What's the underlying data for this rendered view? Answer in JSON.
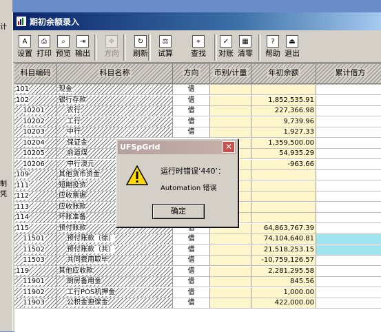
{
  "background_window": {
    "fragments": [
      "计",
      "制凭"
    ]
  },
  "window": {
    "title": "期初余额录入"
  },
  "toolbar": [
    {
      "key": "settings",
      "label": "设置",
      "icon": "A",
      "disabled": false
    },
    {
      "key": "print",
      "label": "打印",
      "icon": "⎙",
      "disabled": false
    },
    {
      "key": "preview",
      "label": "预览",
      "icon": "⌕",
      "disabled": false
    },
    {
      "key": "export",
      "label": "输出",
      "icon": "⇥",
      "disabled": false
    },
    {
      "key": "direction",
      "label": "方向",
      "icon": "✥",
      "disabled": true
    },
    {
      "key": "refresh",
      "label": "刷新",
      "icon": "↻",
      "disabled": false
    },
    {
      "key": "trial",
      "label": "试算",
      "icon": "⚖",
      "disabled": false
    },
    {
      "key": "find",
      "label": "查找",
      "icon": "⌖",
      "disabled": false
    },
    {
      "key": "reconcile",
      "label": "对账",
      "icon": "✓",
      "disabled": false
    },
    {
      "key": "clear",
      "label": "清零",
      "icon": "▦",
      "disabled": false
    },
    {
      "key": "help",
      "label": "帮助",
      "icon": "?",
      "disabled": false
    },
    {
      "key": "exit",
      "label": "退出",
      "icon": "⏏",
      "disabled": false
    }
  ],
  "grid": {
    "headers": [
      "科目编码",
      "科目名称",
      "方向",
      "币别/计量",
      "年初余额",
      "累计借方"
    ],
    "rows": [
      {
        "code": "101",
        "name": "现金",
        "dir": "借",
        "fc": "",
        "amount": "",
        "debit": ""
      },
      {
        "code": "102",
        "name": "银行存款",
        "dir": "借",
        "fc": "",
        "amount": "1,852,535.91",
        "debit": ""
      },
      {
        "code": "10201",
        "name": "农行",
        "dir": "借",
        "fc": "",
        "amount": "227,366.98",
        "debit": ""
      },
      {
        "code": "10202",
        "name": "工行",
        "dir": "借",
        "fc": "",
        "amount": "9,739.96",
        "debit": ""
      },
      {
        "code": "10203",
        "name": "中行",
        "dir": "借",
        "fc": "",
        "amount": "1,927.33",
        "debit": ""
      },
      {
        "code": "10204",
        "name": "保证金",
        "dir": "借",
        "fc": "",
        "amount": "1,359,500.00",
        "debit": ""
      },
      {
        "code": "10205",
        "name": "俞道煤",
        "dir": "借",
        "fc": "",
        "amount": "54,935.29",
        "debit": ""
      },
      {
        "code": "10206",
        "name": "中行澳元",
        "dir": "借",
        "fc": "",
        "amount": "-963.66",
        "debit": ""
      },
      {
        "code": "109",
        "name": "其他货币资金",
        "dir": "借",
        "fc": "",
        "amount": "",
        "debit": ""
      },
      {
        "code": "111",
        "name": "短期投资",
        "dir": "借",
        "fc": "",
        "amount": "",
        "debit": ""
      },
      {
        "code": "112",
        "name": "应收票据",
        "dir": "借",
        "fc": "",
        "amount": "",
        "debit": ""
      },
      {
        "code": "113",
        "name": "应收账款",
        "dir": "借",
        "fc": "",
        "amount": "",
        "debit": ""
      },
      {
        "code": "114",
        "name": "坏账准备",
        "dir": "贷",
        "fc": "",
        "amount": "",
        "debit": ""
      },
      {
        "code": "115",
        "name": "预付账款",
        "dir": "借",
        "fc": "",
        "amount": "64,863,767.39",
        "debit": ""
      },
      {
        "code": "11501",
        "name": "预付账款（徐）",
        "dir": "借",
        "fc": "",
        "amount": "74,104,640.81",
        "debit": ""
      },
      {
        "code": "11502",
        "name": "预付账款（共）",
        "dir": "借",
        "fc": "",
        "amount": "21,518,253.15",
        "debit": ""
      },
      {
        "code": "11503",
        "name": "共同费用取毕",
        "dir": "借",
        "fc": "",
        "amount": "-10,759,126.57",
        "debit": ""
      },
      {
        "code": "119",
        "name": "其他应收款",
        "dir": "借",
        "fc": "",
        "amount": "2,281,295.58",
        "debit": ""
      },
      {
        "code": "11901",
        "name": "厨房备用金",
        "dir": "借",
        "fc": "",
        "amount": "845.56",
        "debit": ""
      },
      {
        "code": "11902",
        "name": "工行POS机押金",
        "dir": "借",
        "fc": "",
        "amount": "1,000.00",
        "debit": ""
      },
      {
        "code": "11903",
        "name": "公积金担保金",
        "dir": "借",
        "fc": "",
        "amount": "422,000.00",
        "debit": ""
      }
    ]
  },
  "dialog": {
    "title": "UFSpGrid",
    "close": "✕",
    "message_line1": "运行时错误‘440’：",
    "message_line2": "Automation 错误",
    "ok_label": "确定"
  }
}
